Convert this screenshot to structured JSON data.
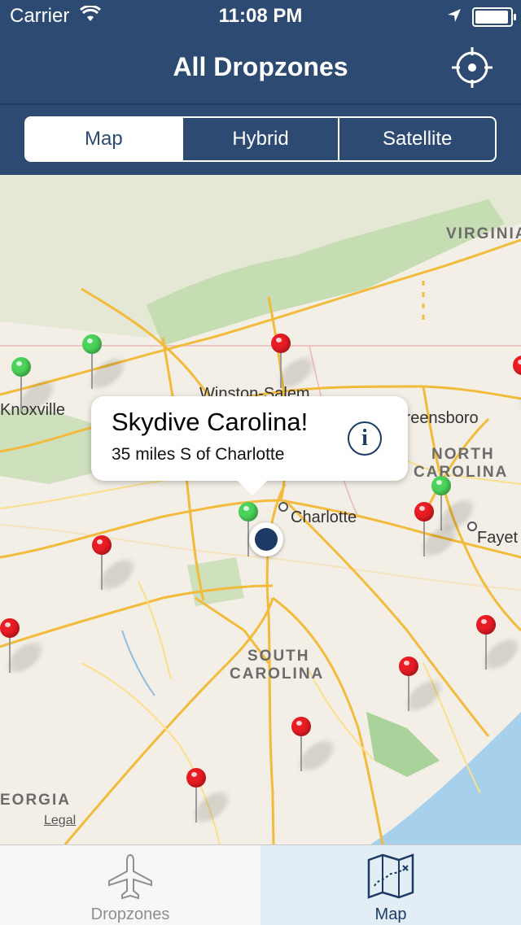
{
  "status": {
    "carrier": "Carrier",
    "time": "11:08 PM",
    "battery_level": 0.95
  },
  "nav": {
    "title": "All Dropzones",
    "locate_icon": "crosshair-icon"
  },
  "segments": [
    {
      "label": "Map",
      "active": true
    },
    {
      "label": "Hybrid",
      "active": false
    },
    {
      "label": "Satellite",
      "active": false
    }
  ],
  "callout": {
    "title": "Skydive Carolina!",
    "subtitle": "35 miles S of Charlotte",
    "info_icon": "i"
  },
  "map_labels": {
    "virginia": "VIRGINIA",
    "winston": "Winston-Salem",
    "knoxville": "Knoxville",
    "greensboro": "Greensboro",
    "north": "NORTH",
    "carolina_n": "CAROLINA",
    "charlotte": "Charlotte",
    "fayetteville": "Fayet",
    "south": "SOUTH",
    "carolina_s": "CAROLINA",
    "georgia": "EORGIA",
    "legal": "Legal"
  },
  "colors": {
    "nav": "#2d4a73",
    "pin_red": "#ea1c24",
    "pin_green": "#4cd35a",
    "water": "#a6d0ec"
  },
  "tabbar": [
    {
      "label": "Dropzones",
      "icon": "airplane-icon",
      "active": false
    },
    {
      "label": "Map",
      "icon": "map-icon",
      "active": true
    }
  ]
}
